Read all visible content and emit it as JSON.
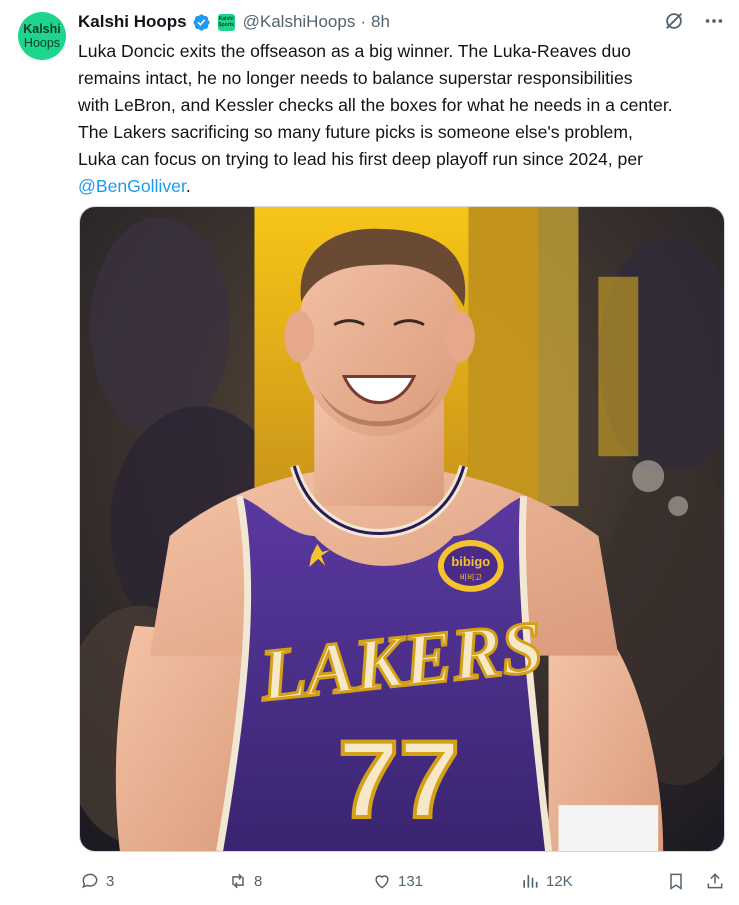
{
  "tweet": {
    "avatar_line1": "Kalshi",
    "avatar_line2": "Hoops",
    "author_name": "Kalshi Hoops",
    "badge_line1": "Kalshi",
    "badge_line2": "Sports",
    "handle": "@KalshiHoops",
    "separator": "·",
    "time": "8h",
    "text_lines": [
      "Luka Doncic exits the offseason as a big winner. The Luka-Reaves duo",
      "remains intact, he no longer needs to balance superstar responsibilities",
      "with LeBron, and Kessler checks all the boxes for what he needs in a center.",
      "The Lakers sacrificing so many future picks is someone else's problem,",
      "Luka can focus on trying to lead his first deep playoff run since 2024, per"
    ],
    "mention": "@BenGolliver",
    "mention_suffix": ".",
    "image": {
      "jersey_wordmark": "LAKERS",
      "jersey_number": "77",
      "patch_text": "bibigo",
      "patch_subtext": "비비고"
    }
  },
  "actions": {
    "replies": "3",
    "reposts": "8",
    "likes": "131",
    "views": "12K"
  },
  "colors": {
    "accent": "#1d9bf0",
    "muted": "#536471",
    "avatar_bg": "#1ed58d",
    "jersey_purple": "#4b2b86",
    "jersey_gold": "#f5c42c"
  },
  "icons": [
    "verified-badge-icon",
    "grok-icon",
    "more-icon",
    "reply-icon",
    "repost-icon",
    "like-icon",
    "views-icon",
    "bookmark-icon",
    "share-icon"
  ]
}
